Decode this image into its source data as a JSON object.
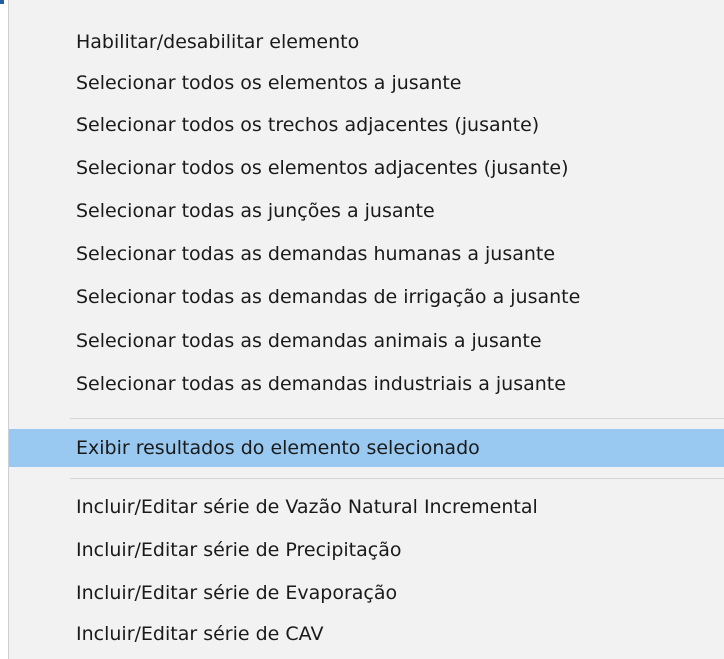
{
  "menu": {
    "group1": [
      "Habilitar/desabilitar elemento",
      "Selecionar todos os elementos a jusante",
      "Selecionar todos os trechos adjacentes (jusante)",
      "Selecionar todos os elementos adjacentes (jusante)",
      "Selecionar todas as junções a jusante",
      "Selecionar todas as demandas humanas a jusante",
      "Selecionar todas as demandas de irrigação a jusante",
      "Selecionar todas as demandas animais a jusante",
      "Selecionar todas as demandas industriais a jusante"
    ],
    "group2": [
      "Exibir resultados do elemento selecionado"
    ],
    "group3": [
      "Incluir/Editar série de Vazão Natural Incremental",
      "Incluir/Editar série de Precipitação",
      "Incluir/Editar série de Evaporação",
      "Incluir/Editar série de CAV"
    ]
  },
  "colors": {
    "highlight": "#99c9f0",
    "menu_background": "#f2f2f2",
    "separator": "#d6d6d6",
    "text": "#1a1a1a"
  }
}
